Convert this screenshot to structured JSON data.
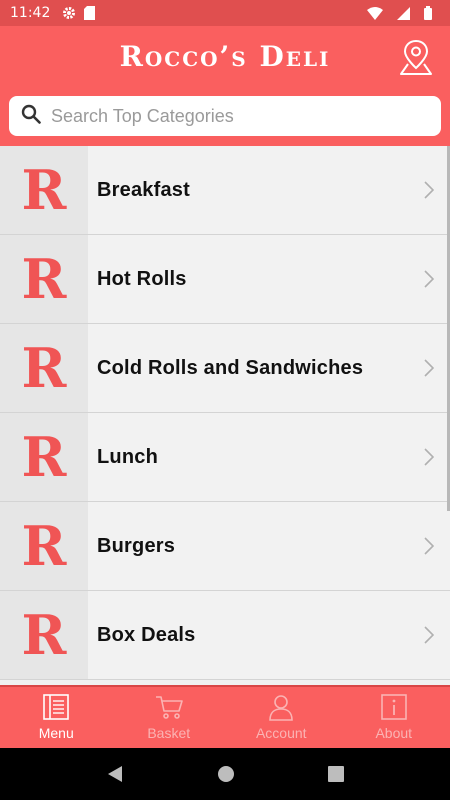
{
  "status_bar": {
    "time": "11:42"
  },
  "header": {
    "title": "Rocco’s Deli"
  },
  "search": {
    "placeholder": "Search Top Categories"
  },
  "categories": [
    {
      "logo": "R",
      "label": "Breakfast"
    },
    {
      "logo": "R",
      "label": "Hot Rolls"
    },
    {
      "logo": "R",
      "label": "Cold Rolls and Sandwiches"
    },
    {
      "logo": "R",
      "label": "Lunch"
    },
    {
      "logo": "R",
      "label": "Burgers"
    },
    {
      "logo": "R",
      "label": "Box Deals"
    }
  ],
  "tabs": [
    {
      "label": "Menu",
      "icon": "menu-book-icon",
      "active": true
    },
    {
      "label": "Basket",
      "icon": "cart-icon",
      "active": false
    },
    {
      "label": "Account",
      "icon": "person-icon",
      "active": false
    },
    {
      "label": "About",
      "icon": "info-icon",
      "active": false
    }
  ],
  "colors": {
    "brand": "#fa5f5f",
    "status_bar": "#e04f4f",
    "logo_red": "#f05555"
  }
}
